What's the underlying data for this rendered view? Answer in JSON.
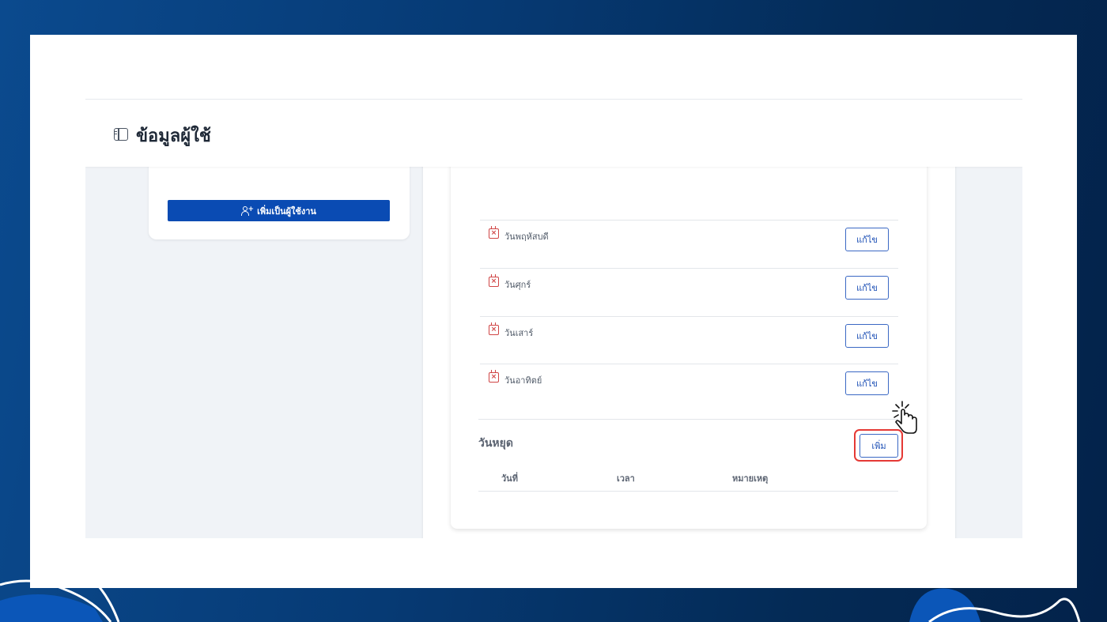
{
  "header": {
    "title": "ข้อมูลผู้ใช้",
    "icon": "sidebar-panel-icon"
  },
  "left_card": {
    "add_user_button": "เพิ่มเป็นผู้ใช้งาน",
    "add_user_icon": "user-plus-icon"
  },
  "schedule": {
    "edit_label": "แก้ไข",
    "days": [
      {
        "label": "วันพฤหัสบดี",
        "icon": "calendar-x-icon"
      },
      {
        "label": "วันศุกร์",
        "icon": "calendar-x-icon"
      },
      {
        "label": "วันเสาร์",
        "icon": "calendar-x-icon"
      },
      {
        "label": "วันอาทิตย์",
        "icon": "calendar-x-icon"
      }
    ]
  },
  "holidays": {
    "title": "วันหยุด",
    "add_label": "เพิ่ม",
    "columns": [
      "วันที่",
      "เวลา",
      "หมายเหตุ"
    ]
  },
  "colors": {
    "primary": "#0a4bb3",
    "outline_blue": "#3a68c4",
    "danger": "#d04545",
    "highlight": "#e53935",
    "background": "#f0f3f7"
  }
}
